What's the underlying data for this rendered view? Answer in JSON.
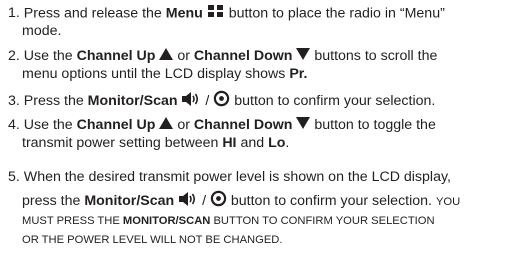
{
  "steps": [
    {
      "num": "1.",
      "a": "Press and release the ",
      "b_menu": "Menu",
      "c": " button to place the radio in “Menu”",
      "line2": "mode."
    },
    {
      "num": "2.",
      "a": "Use the ",
      "b_up": "Channel Up",
      "c": " or ",
      "b_down": "Channel Down",
      "d": "  buttons to scroll the",
      "line2_a": "menu options until the LCD display shows ",
      "line2_b": "Pr.",
      "line2_c": ""
    },
    {
      "num": "3.",
      "a": "Press the ",
      "b": "Monitor/Scan",
      "c": " / ",
      "d": " button to confirm your selection."
    },
    {
      "num": "4.",
      "a": "Use the ",
      "b_up": "Channel Up",
      "c": " or ",
      "b_down": "Channel Down",
      "d": "  button to toggle the",
      "line2_a": "transmit power setting between ",
      "line2_hi": "HI",
      "line2_and": " and ",
      "line2_lo": "Lo",
      "line2_end": "."
    },
    {
      "num": "5.",
      "a": "When the desired transmit power level is shown on the LCD display,",
      "line2_a": "press the ",
      "line2_b": "Monitor/Scan",
      "line2_c": " / ",
      "line2_d": " button to confirm your selection. ",
      "line2_caps": "YOU",
      "line3_a": "MUST PRESS THE ",
      "line3_b": "MONITOR/SCAN",
      "line3_c": " BUTTON TO CONFIRM YOUR SELECTION",
      "line4": "OR THE POWER LEVEL WILL NOT BE CHANGED."
    }
  ],
  "icons": {
    "menu": "menu-grid-icon",
    "up": "triangle-up-icon",
    "down": "triangle-down-icon",
    "speaker": "speaker-icon",
    "scan": "scan-icon"
  }
}
